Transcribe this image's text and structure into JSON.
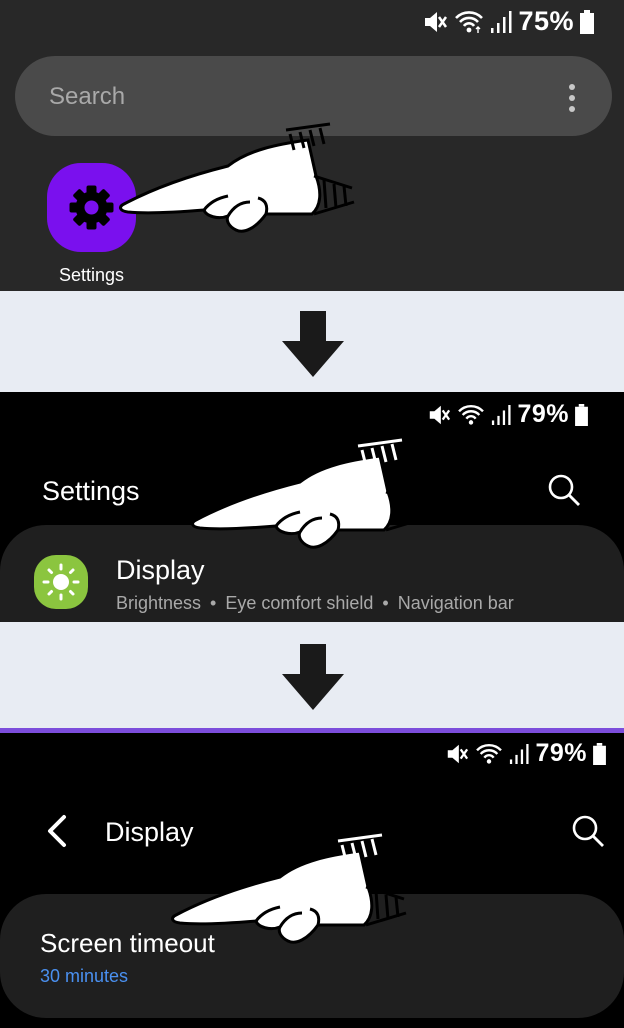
{
  "step1": {
    "status": {
      "battery": "75%"
    },
    "search": {
      "placeholder": "Search"
    },
    "app": {
      "label": "Settings",
      "icon": "gear-icon",
      "color": "#7a10ee"
    }
  },
  "step2": {
    "status": {
      "battery": "79%"
    },
    "header": {
      "title": "Settings"
    },
    "item": {
      "label": "Display",
      "icon": "sun-icon",
      "icon_color": "#8bc53f",
      "subtitle": [
        "Brightness",
        "Eye comfort shield",
        "Navigation bar"
      ],
      "separator": "•"
    }
  },
  "step3": {
    "status": {
      "battery": "79%"
    },
    "header": {
      "title": "Display"
    },
    "item": {
      "label": "Screen timeout",
      "value": "30 minutes",
      "value_color": "#4a90f0"
    }
  },
  "colors": {
    "divider": "#e8ecf3",
    "accent_line": "#7c4ddb"
  }
}
